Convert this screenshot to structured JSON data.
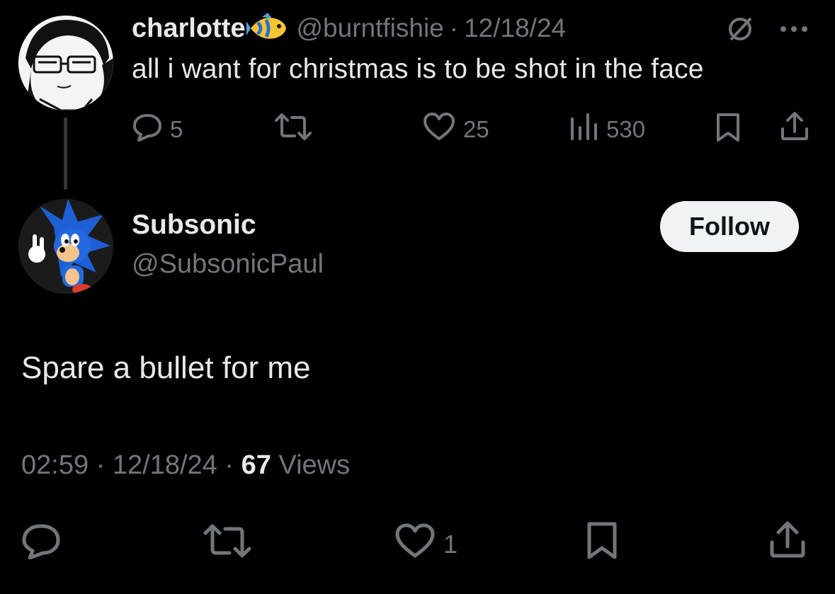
{
  "parent": {
    "name": "charlotte",
    "handle": "@burntfishie",
    "separator": "·",
    "date": "12/18/24",
    "text": "all i want for christmas is to be shot in the face",
    "replies": "5",
    "likes": "25",
    "views": "530"
  },
  "reply": {
    "name": "Subsonic",
    "handle": "@SubsonicPaul",
    "follow_label": "Follow",
    "text": "Spare a bullet for me",
    "time": "02:59",
    "sep1": "·",
    "date": "12/18/24",
    "sep2": "·",
    "views_count": "67",
    "views_label": "Views",
    "likes": "1"
  },
  "colors": {
    "background": "#000000",
    "text": "#e7e9ea",
    "muted": "#71767b",
    "button_bg": "#eff3f4"
  },
  "icons": [
    "reply-icon",
    "retweet-icon",
    "like-icon",
    "views-icon",
    "bookmark-icon",
    "share-icon",
    "slash-icon",
    "more-icon",
    "fish-emoji"
  ]
}
